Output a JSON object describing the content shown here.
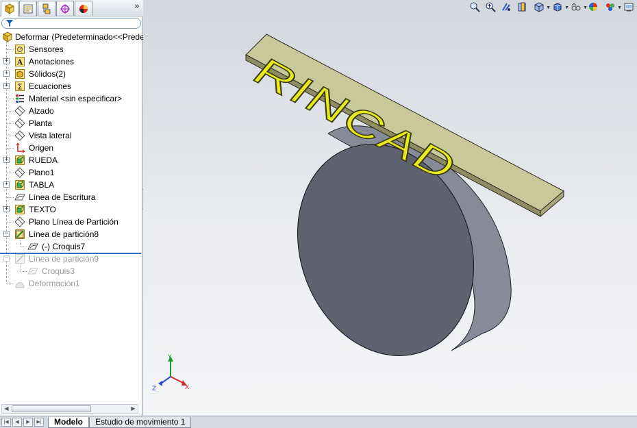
{
  "panel": {
    "tabs": [
      {
        "name": "feature-manager",
        "icon": "feature-tree-icon"
      },
      {
        "name": "property-manager",
        "icon": "property-manager-icon"
      },
      {
        "name": "configuration-manager",
        "icon": "configuration-manager-icon"
      },
      {
        "name": "dimxpert-manager",
        "icon": "dimxpert-icon"
      },
      {
        "name": "display-manager",
        "icon": "display-manager-icon"
      }
    ],
    "more": "»"
  },
  "tree": {
    "root": "Deformar  (Predeterminado<<Predeterminado>)",
    "items": [
      {
        "label": "Sensores",
        "icon": "sensor-icon"
      },
      {
        "label": "Anotaciones",
        "icon": "annotation-icon"
      },
      {
        "label": "Sólidos(2)",
        "icon": "solid-bodies-icon"
      },
      {
        "label": "Ecuaciones",
        "icon": "equations-icon"
      },
      {
        "label": "Material <sin especificar>",
        "icon": "material-icon"
      },
      {
        "label": "Alzado",
        "icon": "plane-icon"
      },
      {
        "label": "Planta",
        "icon": "plane-icon"
      },
      {
        "label": "Vista lateral",
        "icon": "plane-icon"
      },
      {
        "label": "Origen",
        "icon": "origin-icon"
      },
      {
        "label": "RUEDA",
        "icon": "extrude-feature-icon"
      },
      {
        "label": "Plano1",
        "icon": "plane-icon"
      },
      {
        "label": "TABLA",
        "icon": "extrude-feature-icon"
      },
      {
        "label": "Línea de Escritura",
        "icon": "sketch-icon"
      },
      {
        "label": "TEXTO",
        "icon": "extrude-feature-icon"
      },
      {
        "label": "Plano Línea de Partición",
        "icon": "plane-icon"
      },
      {
        "label": "Línea de partición8",
        "icon": "split-line-icon"
      },
      {
        "label": "(-) Croquis7",
        "icon": "sketch-icon"
      },
      {
        "label": "Línea de partición9",
        "icon": "split-line-icon"
      },
      {
        "label": "Croquis3",
        "icon": "sketch-icon"
      },
      {
        "label": "Deformación1",
        "icon": "deform-feature-icon"
      }
    ]
  },
  "viewport": {
    "model_text": "RINCAD",
    "triad": {
      "x": "X",
      "y": "Y",
      "z": "Z"
    },
    "colors": {
      "plate": "#c9c89a",
      "letters": "#e8ea1f",
      "wheel_face": "#5f6270",
      "wheel_side": "#878a98"
    }
  },
  "toolbar": {
    "icons": [
      "zoom-to-fit-icon",
      "zoom-to-area-icon",
      "previous-view-icon",
      "section-view-icon",
      "view-orientation-icon",
      "display-style-icon",
      "hide-show-items-icon",
      "edit-appearance-icon",
      "apply-scene-icon",
      "view-settings-icon"
    ]
  },
  "bottom_tabs": {
    "model": "Modelo",
    "motion": "Estudio de movimiento 1"
  }
}
